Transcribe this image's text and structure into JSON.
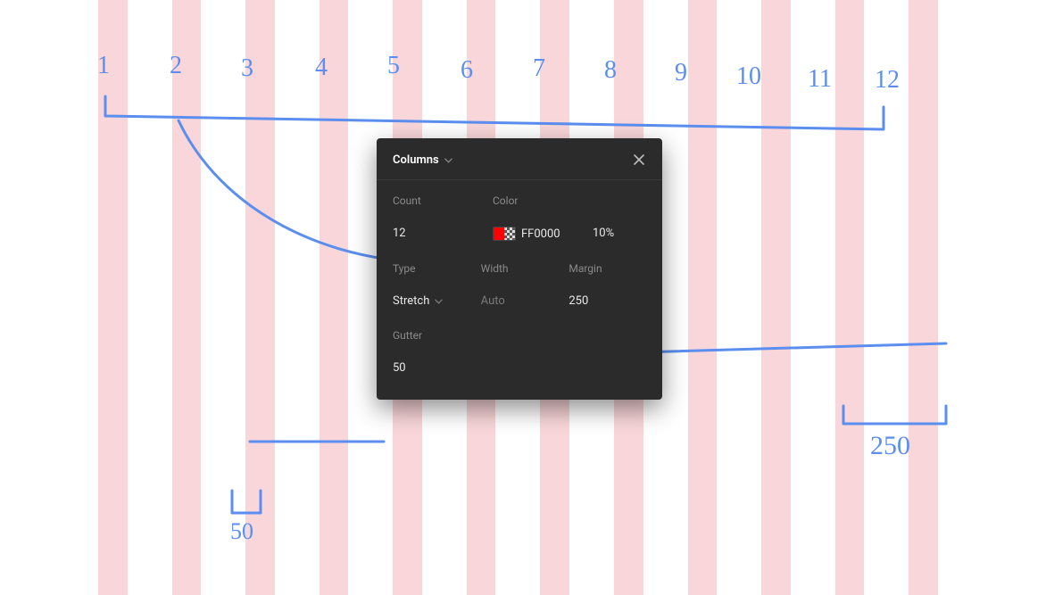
{
  "panel": {
    "title": "Columns",
    "labels": {
      "count": "Count",
      "color": "Color",
      "type": "Type",
      "width": "Width",
      "margin": "Margin",
      "gutter": "Gutter"
    },
    "values": {
      "count": "12",
      "color_hex": "FF0000",
      "color_opacity": "10%",
      "type": "Stretch",
      "width": "Auto",
      "margin": "250",
      "gutter": "50"
    }
  },
  "annotations": {
    "column_numbers": [
      "1",
      "2",
      "3",
      "4",
      "5",
      "6",
      "7",
      "8",
      "9",
      "10",
      "11",
      "12"
    ],
    "margin_label": "250",
    "gutter_label": "50"
  },
  "colors": {
    "stripe": "#f8d6d9",
    "ink": "#5b8eef",
    "panel_bg": "#2b2b2b"
  }
}
